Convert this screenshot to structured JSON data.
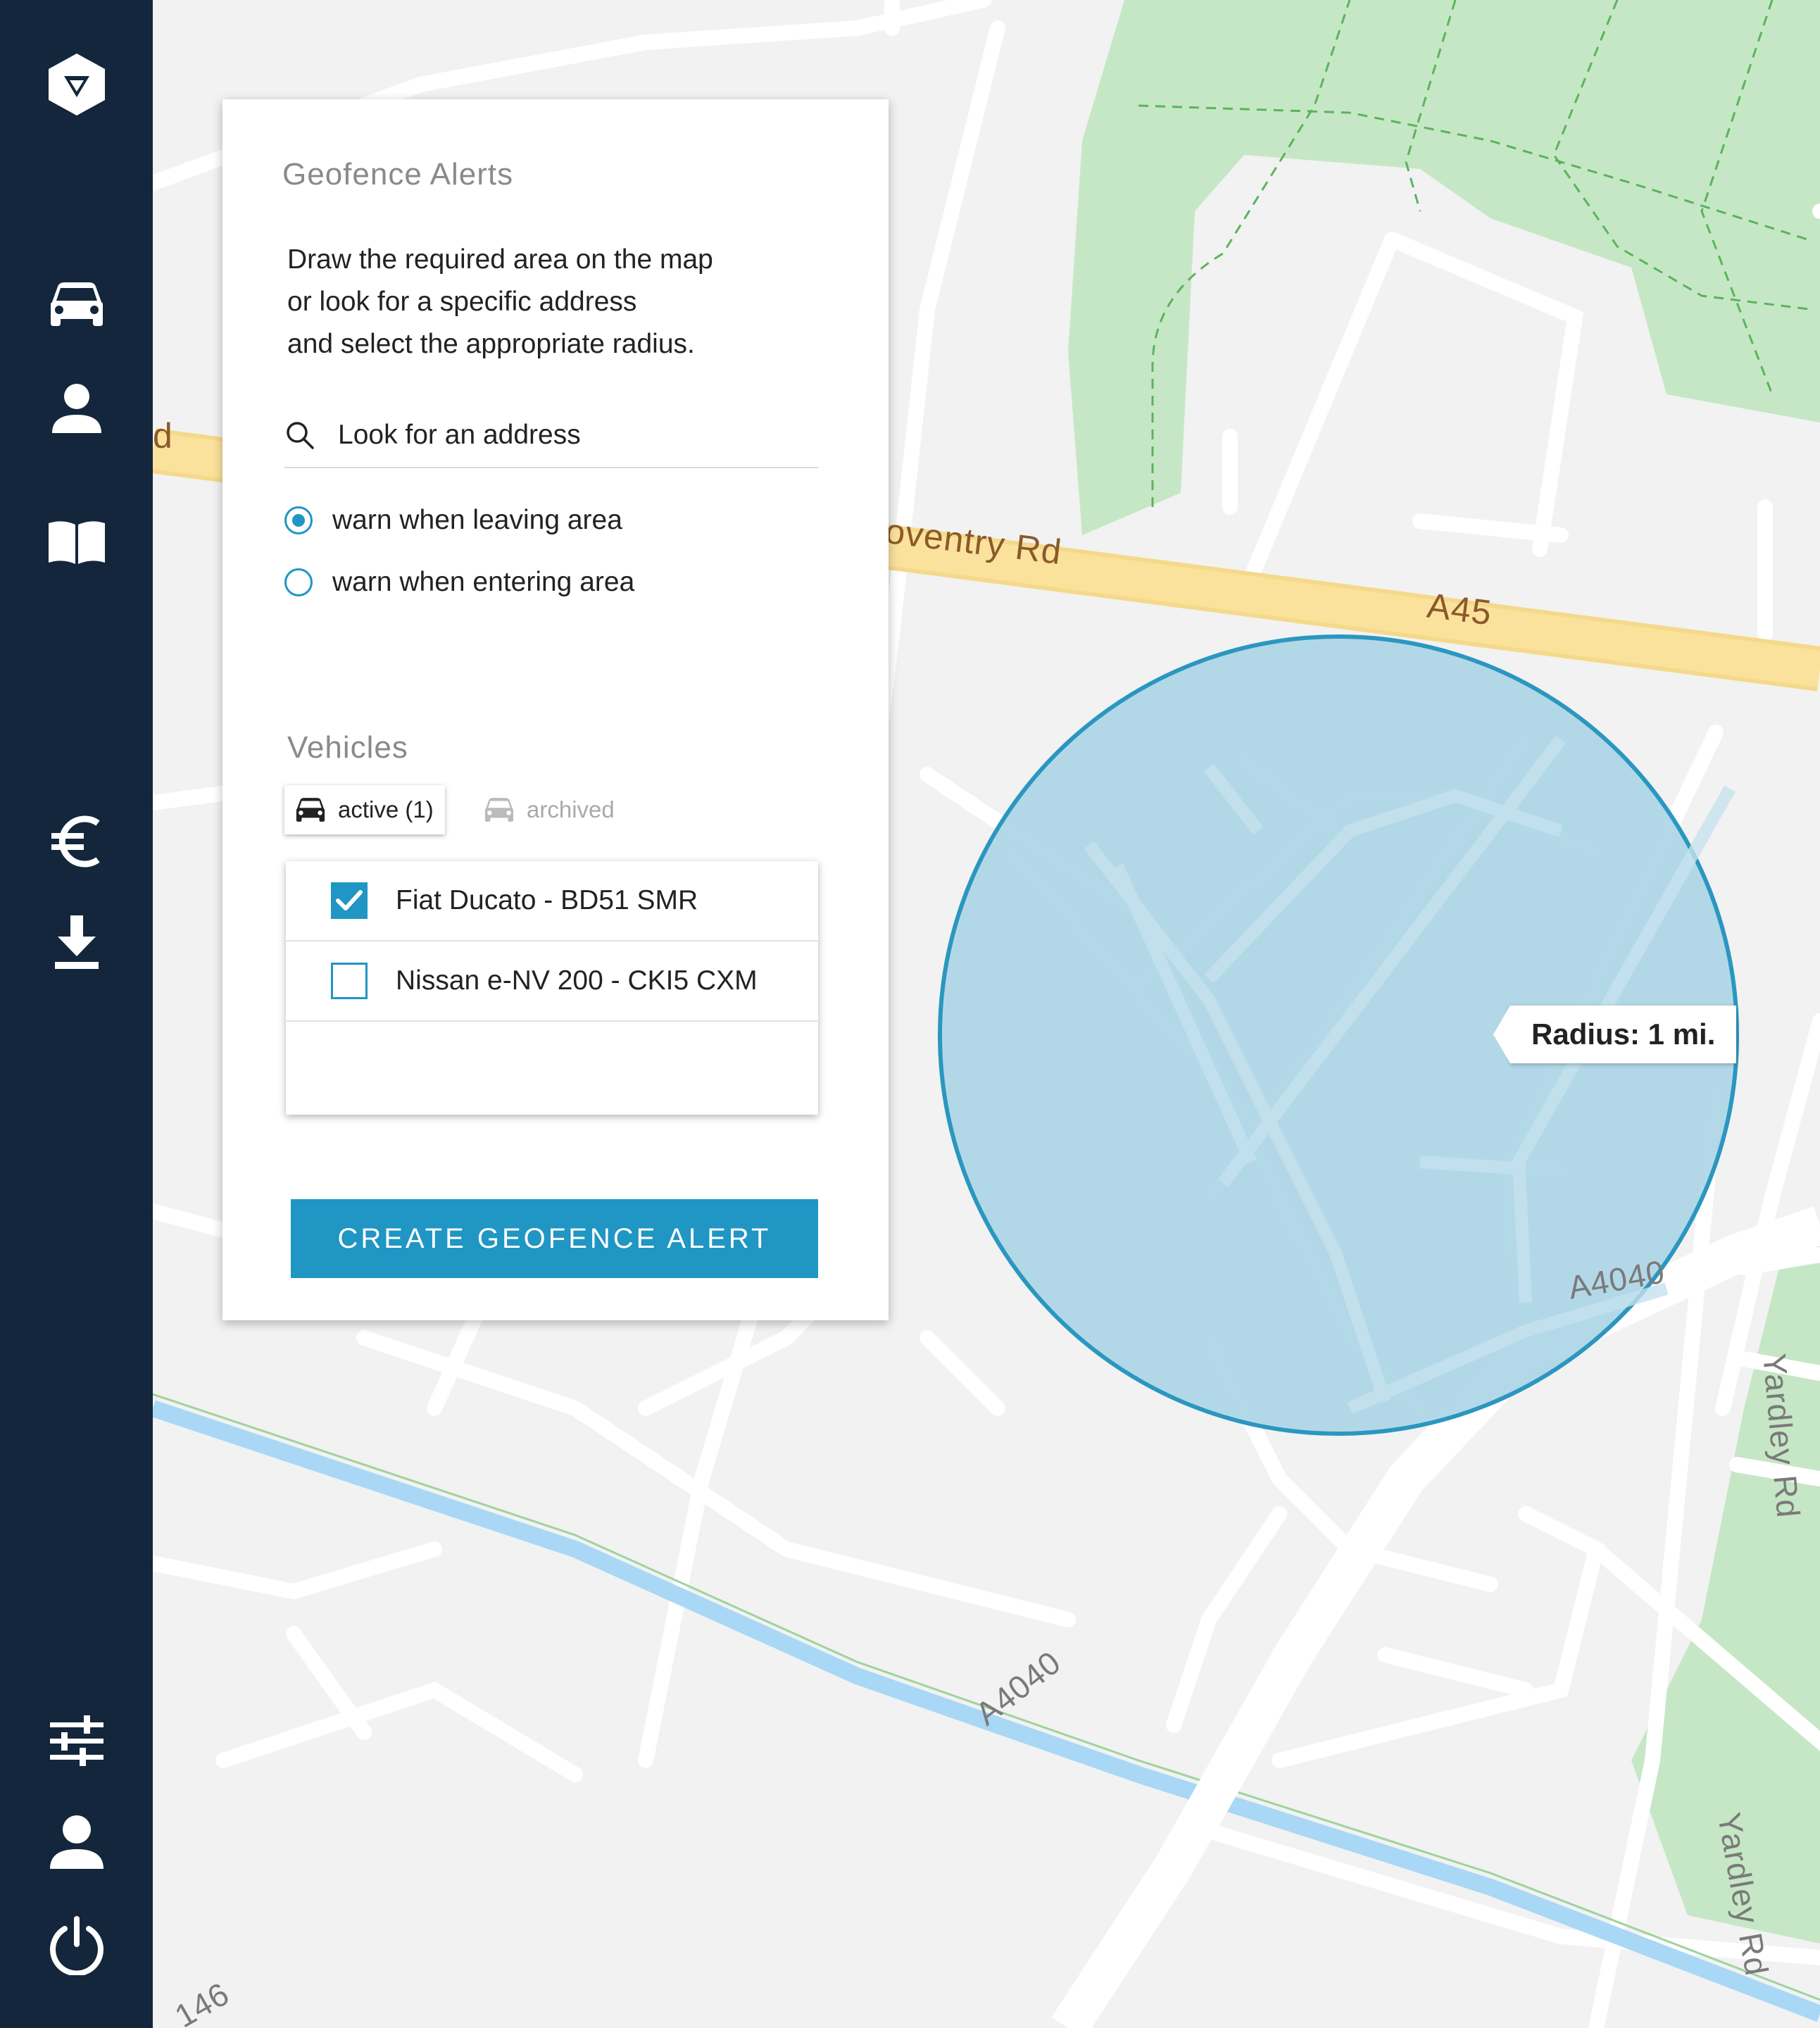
{
  "sidebar": {
    "icons": [
      "logo-icon",
      "car-icon",
      "user-icon",
      "book-icon",
      "euro-icon",
      "download-icon",
      "sliders-icon",
      "account-icon",
      "power-icon"
    ]
  },
  "panel": {
    "title": "Geofence Alerts",
    "description": [
      "Draw the required area on the map",
      "or look for a specific address",
      "and select the appropriate radius."
    ],
    "search_placeholder": "Look for an address",
    "options": [
      {
        "label": "warn when leaving area",
        "selected": true
      },
      {
        "label": "warn when entering area",
        "selected": false
      }
    ],
    "vehicles_title": "Vehicles",
    "tabs": {
      "active": "active (1)",
      "archived": "archived"
    },
    "vehicles": [
      {
        "label": "Fiat Ducato - BD51 SMR",
        "checked": true
      },
      {
        "label": "Nissan e-NV 200 - CKI5 CXM",
        "checked": false
      }
    ],
    "create_button": "CREATE GEOFENCE ALERT"
  },
  "map": {
    "radius_label": "Radius: 1 mi.",
    "road_labels": {
      "coventry": "oventry Rd",
      "a45": "A45",
      "a4040_right": "A4040",
      "a4040_bottom": "A4040",
      "yardley_top": "Yardley Rd",
      "yardley_bottom": "Yardley Rd",
      "bottom_left": "146",
      "left_edge": "d"
    },
    "colors": {
      "geofence_fill": "#a9d4e6",
      "geofence_stroke": "#2b97c0",
      "park": "#c6e7c5",
      "water": "#a8d8f5",
      "major_road": "#fbe29c"
    }
  },
  "colors": {
    "sidebar": "#13263c",
    "accent": "#1f96c3"
  }
}
